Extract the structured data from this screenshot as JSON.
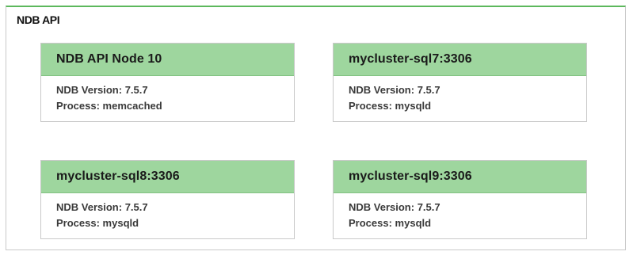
{
  "panel": {
    "title": "NDB API"
  },
  "nodes": [
    {
      "title": "NDB API Node 10",
      "version_label": "NDB Version:",
      "version": "7.5.7",
      "process_label": "Process:",
      "process": "memcached"
    },
    {
      "title": "mycluster-sql7:3306",
      "version_label": "NDB Version:",
      "version": "7.5.7",
      "process_label": "Process:",
      "process": "mysqld"
    },
    {
      "title": "mycluster-sql8:3306",
      "version_label": "NDB Version:",
      "version": "7.5.7",
      "process_label": "Process:",
      "process": "mysqld"
    },
    {
      "title": "mycluster-sql9:3306",
      "version_label": "NDB Version:",
      "version": "7.5.7",
      "process_label": "Process:",
      "process": "mysqld"
    }
  ],
  "colors": {
    "accent": "#5cb85c",
    "card_header": "#9ed69e",
    "border": "#c9c9c9"
  }
}
